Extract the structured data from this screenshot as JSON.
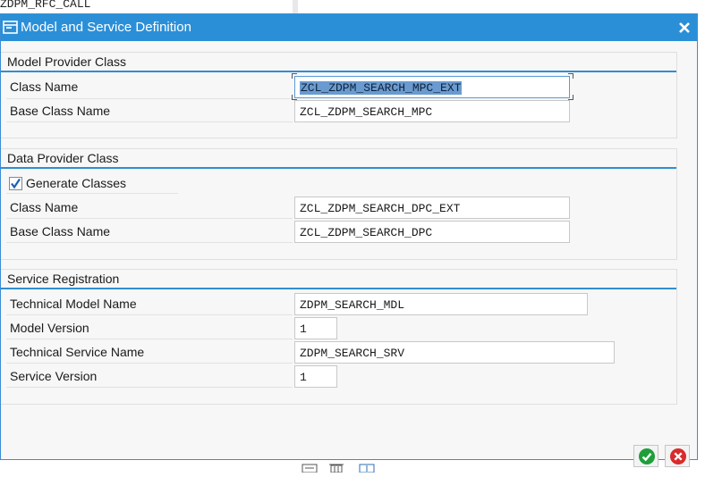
{
  "background": {
    "top_text": "ZDPM_RFC_CALL"
  },
  "dialog": {
    "title": "Model and Service Definition",
    "icons": {
      "title_icon": "window-icon",
      "close": "close-icon"
    }
  },
  "model_provider": {
    "title": "Model Provider Class",
    "class_name_label": "Class Name",
    "class_name_value": "ZCL_ZDPM_SEARCH_MPC_EXT",
    "base_class_label": "Base Class Name",
    "base_class_value": "ZCL_ZDPM_SEARCH_MPC"
  },
  "data_provider": {
    "title": "Data Provider Class",
    "generate_label": "Generate Classes",
    "generate_checked": true,
    "class_name_label": "Class Name",
    "class_name_value": "ZCL_ZDPM_SEARCH_DPC_EXT",
    "base_class_label": "Base Class Name",
    "base_class_value": "ZCL_ZDPM_SEARCH_DPC"
  },
  "service_registration": {
    "title": "Service Registration",
    "tech_model_label": "Technical Model Name",
    "tech_model_value": "ZDPM_SEARCH_MDL",
    "model_version_label": "Model Version",
    "model_version_value": "1",
    "tech_service_label": "Technical Service Name",
    "tech_service_value": "ZDPM_SEARCH_SRV",
    "service_version_label": "Service Version",
    "service_version_value": "1"
  },
  "buttons": {
    "confirm": "confirm-check-icon",
    "cancel": "cancel-x-icon"
  },
  "colors": {
    "titlebar": "#2b8fd8",
    "group_line": "#2f8ed0",
    "confirm_green": "#1f9e3a",
    "cancel_red": "#d92b2b"
  }
}
